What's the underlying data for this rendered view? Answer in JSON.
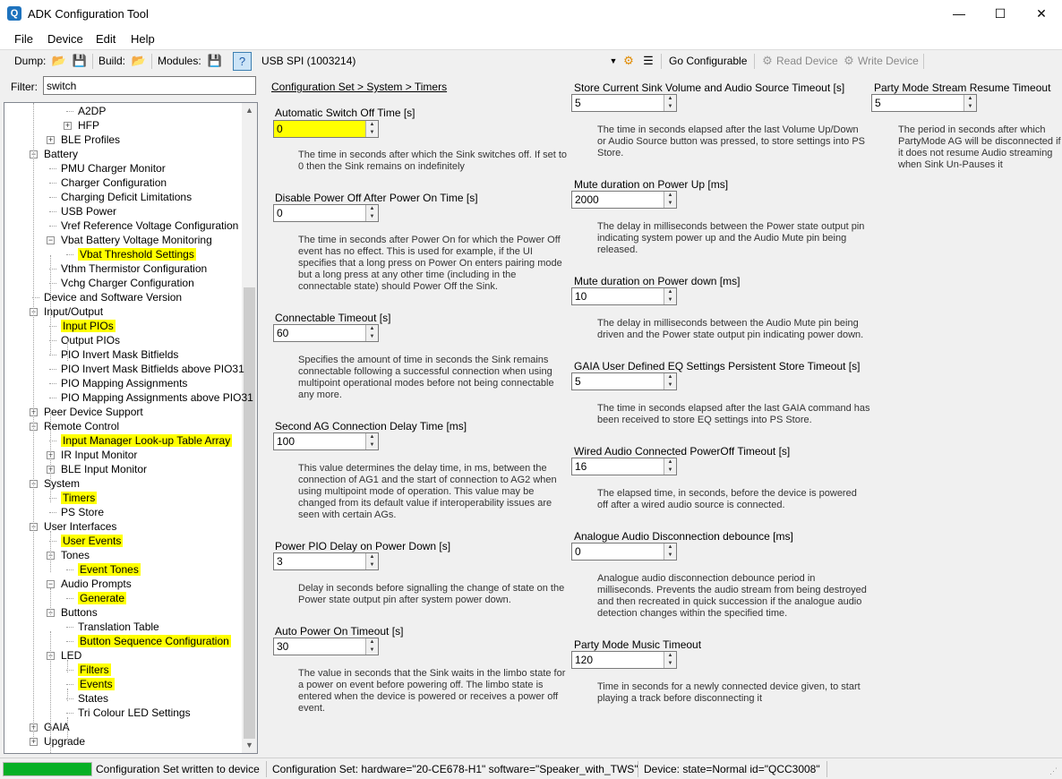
{
  "window": {
    "title": "ADK Configuration Tool",
    "minimize": "—",
    "maximize": "☐",
    "close": "✕"
  },
  "menu": [
    "File",
    "Device",
    "Edit",
    "Help"
  ],
  "toolbar": {
    "dump_label": "Dump:",
    "build_label": "Build:",
    "modules_label": "Modules:",
    "transport": "USB SPI (1003214)",
    "go_configurable": "Go Configurable",
    "read_device": "Read Device",
    "write_device": "Write Device"
  },
  "filter": {
    "label": "Filter:",
    "value": "switch"
  },
  "tree": [
    {
      "label": "A2DP",
      "level": 3,
      "exp": null
    },
    {
      "label": "HFP",
      "level": 3,
      "exp": "+"
    },
    {
      "label": "BLE Profiles",
      "level": 2,
      "exp": "+"
    },
    {
      "label": "Battery",
      "level": 1,
      "exp": "−"
    },
    {
      "label": "PMU Charger Monitor",
      "level": 2,
      "exp": null
    },
    {
      "label": "Charger Configuration",
      "level": 2,
      "exp": null
    },
    {
      "label": "Charging Deficit Limitations",
      "level": 2,
      "exp": null
    },
    {
      "label": "USB Power",
      "level": 2,
      "exp": null
    },
    {
      "label": "Vref Reference Voltage Configuration",
      "level": 2,
      "exp": null
    },
    {
      "label": "Vbat Battery Voltage Monitoring",
      "level": 2,
      "exp": "−"
    },
    {
      "label": "Vbat Threshold Settings",
      "level": 3,
      "exp": null,
      "hl": true
    },
    {
      "label": "Vthm Thermistor Configuration",
      "level": 2,
      "exp": null
    },
    {
      "label": "Vchg Charger Configuration",
      "level": 2,
      "exp": null
    },
    {
      "label": "Device and Software Version",
      "level": 1,
      "exp": null
    },
    {
      "label": "Input/Output",
      "level": 1,
      "exp": "−"
    },
    {
      "label": "Input PIOs",
      "level": 2,
      "exp": null,
      "hl": true
    },
    {
      "label": "Output PIOs",
      "level": 2,
      "exp": null
    },
    {
      "label": "PIO Invert Mask Bitfields",
      "level": 2,
      "exp": null
    },
    {
      "label": "PIO Invert Mask Bitfields above PIO31",
      "level": 2,
      "exp": null
    },
    {
      "label": "PIO Mapping Assignments",
      "level": 2,
      "exp": null
    },
    {
      "label": "PIO Mapping Assignments above PIO31",
      "level": 2,
      "exp": null
    },
    {
      "label": "Peer Device Support",
      "level": 1,
      "exp": "+"
    },
    {
      "label": "Remote Control",
      "level": 1,
      "exp": "−"
    },
    {
      "label": "Input Manager Look-up Table Array",
      "level": 2,
      "exp": null,
      "hl": true
    },
    {
      "label": "IR Input Monitor",
      "level": 2,
      "exp": "+"
    },
    {
      "label": "BLE Input Monitor",
      "level": 2,
      "exp": "+"
    },
    {
      "label": "System",
      "level": 1,
      "exp": "−"
    },
    {
      "label": "Timers",
      "level": 2,
      "exp": null,
      "hl": true
    },
    {
      "label": "PS Store",
      "level": 2,
      "exp": null
    },
    {
      "label": "User Interfaces",
      "level": 1,
      "exp": "−"
    },
    {
      "label": "User Events",
      "level": 2,
      "exp": null,
      "hl": true
    },
    {
      "label": "Tones",
      "level": 2,
      "exp": "−"
    },
    {
      "label": "Event Tones",
      "level": 3,
      "exp": null,
      "hl": true
    },
    {
      "label": "Audio Prompts",
      "level": 2,
      "exp": "−"
    },
    {
      "label": "Generate",
      "level": 3,
      "exp": null,
      "hl": true
    },
    {
      "label": "Buttons",
      "level": 2,
      "exp": "−"
    },
    {
      "label": "Translation Table",
      "level": 3,
      "exp": null
    },
    {
      "label": "Button Sequence Configuration",
      "level": 3,
      "exp": null,
      "hl": true
    },
    {
      "label": "LED",
      "level": 2,
      "exp": "−"
    },
    {
      "label": "Filters",
      "level": 3,
      "exp": null,
      "hl": true
    },
    {
      "label": "Events",
      "level": 3,
      "exp": null,
      "hl": true
    },
    {
      "label": "States",
      "level": 3,
      "exp": null
    },
    {
      "label": "Tri Colour LED Settings",
      "level": 3,
      "exp": null
    },
    {
      "label": "GAIA",
      "level": 1,
      "exp": "+"
    },
    {
      "label": "Upgrade",
      "level": 1,
      "exp": "+"
    }
  ],
  "breadcrumb": "Configuration Set > System > Timers",
  "fields": [
    {
      "label": "Automatic Switch Off Time [s]",
      "value": "0",
      "hl": true,
      "desc": [
        "The time in seconds after which the Sink switches off. If set to",
        "0 then the Sink remains on indefinitely"
      ]
    },
    {
      "label": "Disable Power Off After Power On Time [s]",
      "value": "0",
      "desc": [
        "The time in seconds after Power On for which the Power Off",
        "event has no effect. This is used for example, if the UI",
        "specifies that a long press on Power On enters pairing mode",
        "but a long press at any other time (including in the",
        "connectable state) should Power Off the Sink."
      ]
    },
    {
      "label": "Connectable Timeout [s]",
      "value": "60",
      "desc": [
        "Specifies the amount of time in seconds the Sink remains",
        "connectable following a successful connection when using",
        "multipoint operational modes before not being connectable",
        "any more."
      ]
    },
    {
      "label": "Second AG Connection Delay Time [ms]",
      "value": "100",
      "desc": [
        "This value determines the delay time, in ms, between the",
        "connection of AG1 and the start of connection to AG2 when",
        "using multipoint mode of operation. This value may be",
        "changed from its default value if interoperability issues are",
        "seen with certain AGs."
      ]
    },
    {
      "label": "Power PIO Delay on Power Down [s]",
      "value": "3",
      "desc": [
        "Delay in seconds before signalling the change of state on the",
        "Power state output pin after system power down."
      ]
    },
    {
      "label": "Auto Power On Timeout [s]",
      "value": "30",
      "desc": [
        "The value in seconds that the Sink waits in the limbo state for",
        "a power on event before powering off. The limbo state is",
        "entered when the device is powered or receives a power off",
        "event."
      ]
    },
    {
      "label": "Store Current Sink Volume and Audio Source Timeout [s]",
      "value": "5",
      "desc": [
        "The time in seconds elapsed after the last Volume Up/Down",
        "or Audio Source button was pressed, to store settings into PS",
        "Store."
      ]
    },
    {
      "label": "Mute duration on Power Up [ms]",
      "value": "2000",
      "desc": [
        "The delay in milliseconds between the Power state output pin",
        "indicating system power up and the Audio Mute pin being",
        "released."
      ]
    },
    {
      "label": "Mute duration on Power down [ms]",
      "value": "10",
      "desc": [
        "The delay in milliseconds between the Audio Mute pin being",
        "driven and the Power state output pin indicating power down."
      ]
    },
    {
      "label": "GAIA User Defined EQ Settings Persistent Store Timeout [s]",
      "value": "5",
      "desc": [
        "The time in seconds elapsed after the last GAIA command has",
        "been received to store EQ settings into PS Store."
      ]
    },
    {
      "label": "Wired Audio Connected PowerOff Timeout [s]",
      "value": "16",
      "desc": [
        "The elapsed time, in seconds, before the device is powered",
        "off after a wired audio source is connected."
      ]
    },
    {
      "label": "Analogue Audio Disconnection debounce [ms]",
      "value": "0",
      "desc": [
        "Analogue audio disconnection debounce period in",
        "milliseconds. Prevents the audio stream from being destroyed",
        "and then recreated in quick succession if the analogue audio",
        "detection changes within the specified time."
      ]
    },
    {
      "label": "Party Mode Music Timeout",
      "value": "120",
      "desc": [
        "Time in seconds for a newly connected device given, to start",
        "playing a track before disconnecting it"
      ]
    },
    {
      "label": "Party Mode Stream Resume Timeout",
      "value": "5",
      "desc": [
        "The period in seconds after which",
        "PartyMode AG will be disconnected if",
        "it does not resume Audio streaming",
        "when Sink Un-Pauses it"
      ]
    }
  ],
  "status": {
    "progress": 1.0,
    "message": "Configuration Set written to device",
    "config_set": "Configuration Set:  hardware=\"20-CE678-H1\" software=\"Speaker_with_TWS\"",
    "device": "Device:  state=Normal id=\"QCC3008\""
  },
  "colors": {
    "highlight": "#ffff00",
    "progress": "#06b025"
  }
}
